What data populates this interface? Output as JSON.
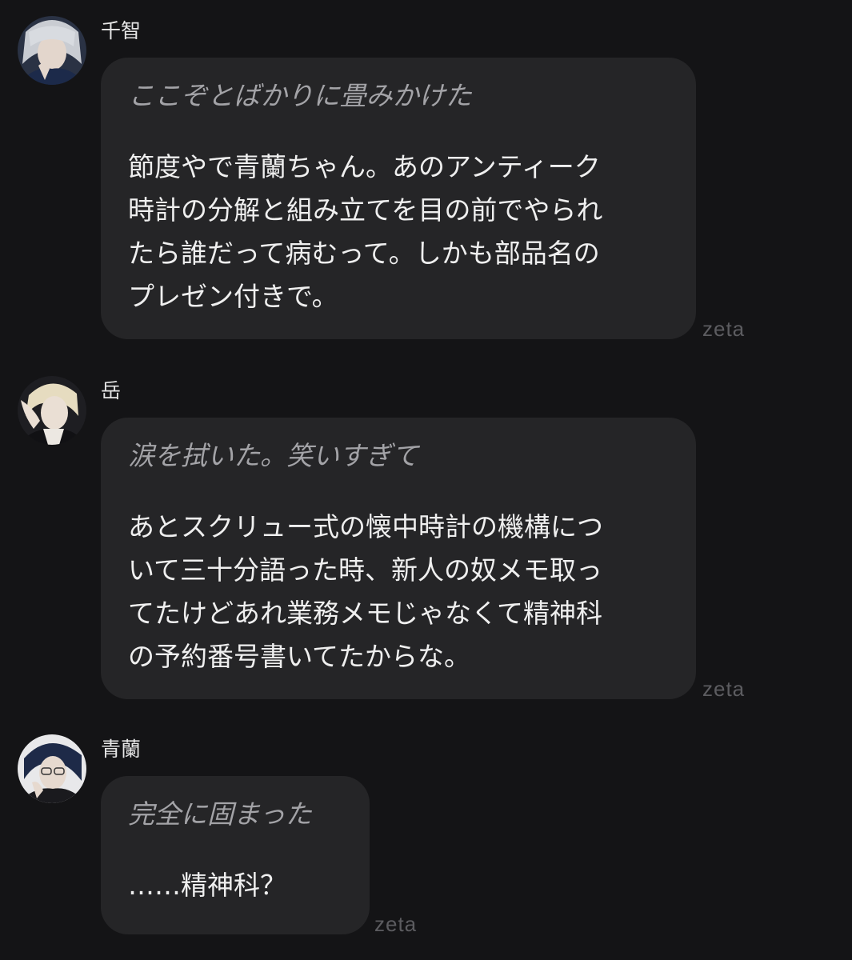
{
  "messages": [
    {
      "sender": "千智",
      "avatar": "chichi-avatar",
      "action": "ここぞとばかりに畳みかけた",
      "speech": "節度やで青蘭ちゃん。あのアンティーク\n時計の分解と組み立てを目の前でやられ\nたら誰だって病むって。しかも部品名の\nプレゼン付きで。",
      "watermark": "zeta"
    },
    {
      "sender": "岳",
      "avatar": "gaku-avatar",
      "action": "涙を拭いた。笑いすぎて",
      "speech": "あとスクリュー式の懐中時計の機構につ\nいて三十分語った時、新人の奴メモ取っ\nてたけどあれ業務メモじゃなくて精神科\nの予約番号書いてたからな。",
      "watermark": "zeta"
    },
    {
      "sender": "青蘭",
      "avatar": "seiran-avatar",
      "action": "完全に固まった",
      "speech": "……精神科？",
      "watermark": "zeta"
    }
  ],
  "colors": {
    "background": "#141416",
    "bubble": "#252527",
    "action_text": "#a3a3a7",
    "speech_text": "#efefef"
  }
}
